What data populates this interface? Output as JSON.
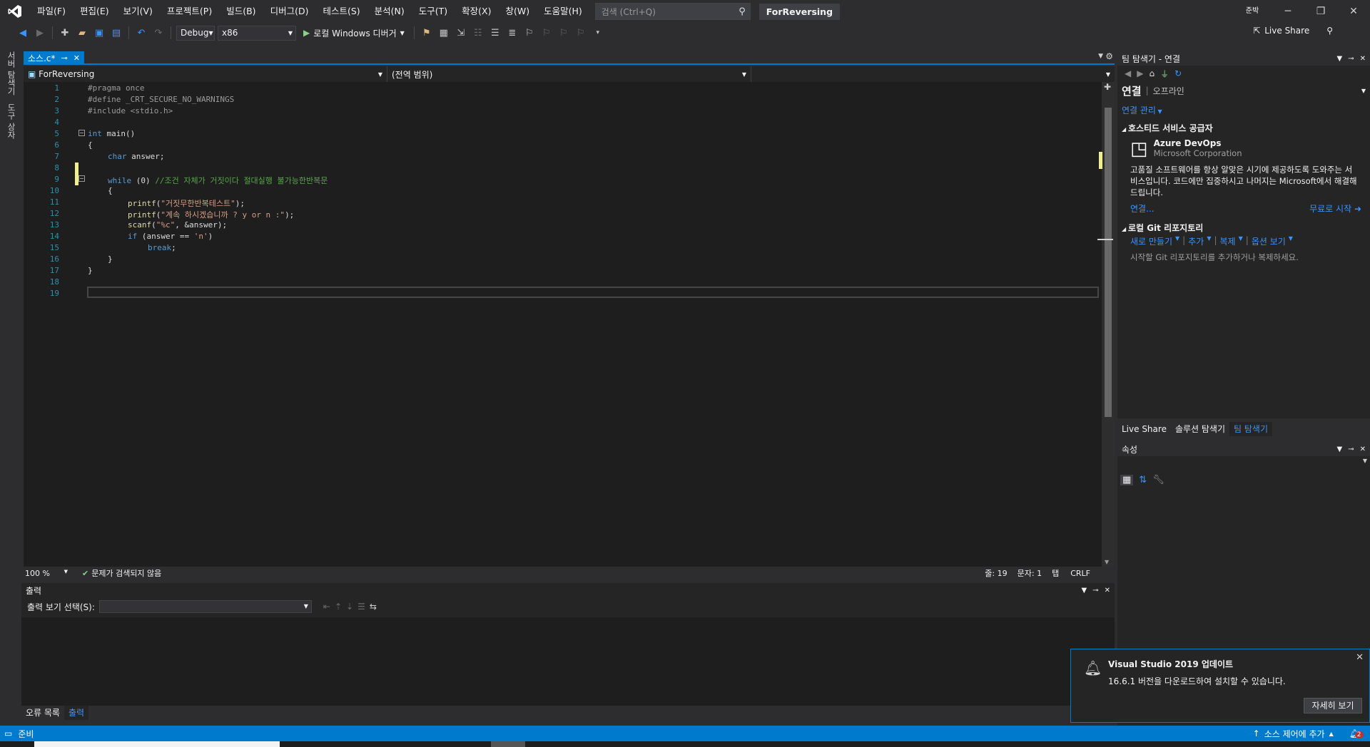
{
  "title_bar": {
    "menu": [
      "파일(F)",
      "편집(E)",
      "보기(V)",
      "프로젝트(P)",
      "빌드(B)",
      "디버그(D)",
      "테스트(S)",
      "분석(N)",
      "도구(T)",
      "확장(X)",
      "창(W)",
      "도움말(H)"
    ],
    "search_placeholder": "검색 (Ctrl+Q)",
    "solution_name": "ForReversing",
    "user_badge": "준박"
  },
  "toolbar": {
    "configuration": "Debug",
    "platform": "x86",
    "debug_launch": "로컬 Windows 디버거",
    "live_share": "Live Share"
  },
  "left_strip": {
    "tabs": [
      "서버 탐색기",
      "도구 상자"
    ]
  },
  "editor": {
    "tab_label": "소스.c*",
    "tab_pin": "ᵖ",
    "nav_project": "ForReversing",
    "nav_scope": "(전역 범위)",
    "line_numbers": [
      "1",
      "2",
      "3",
      "4",
      "5",
      "6",
      "7",
      "8",
      "9",
      "10",
      "11",
      "12",
      "13",
      "14",
      "15",
      "16",
      "17",
      "18",
      "19"
    ],
    "zoom": "100 %",
    "issues": "문제가 검색되지 않음",
    "line_info": "줄: 19",
    "col_info": "문자: 1",
    "tab_mode": "탭",
    "eol": "CRLF"
  },
  "code": {
    "l1": "#pragma once",
    "l2": "#define _CRT_SECURE_NO_WARNINGS",
    "l3": "#include <stdio.h>",
    "l5_kw": "int",
    "l5_rest": " main()",
    "l6": "{",
    "l7_kw": "char",
    "l7_rest": " answer;",
    "l9_kw": "while",
    "l9_rest": " (0) ",
    "l9_comment": "//조건 자체가 거짓이다 절대실행 불가능한반복문",
    "l10": "{",
    "l11_fn": "printf",
    "l11_str": "\"거짓무한반복테스트\"",
    "l12_fn": "printf",
    "l12_str": "\"계속 하시겠습니까 ? y or n :\"",
    "l13_fn": "scanf",
    "l13_str": "\"%c\"",
    "l13_rest": ", &answer);",
    "l14_kw": "if",
    "l14_rest": " (answer == ",
    "l14_str": "'n'",
    "l15_kw": "break",
    "l16": "}",
    "l17": "}"
  },
  "team_explorer": {
    "title": "팀 탐색기 - 연결",
    "heading": "연결",
    "status": "오프라인",
    "manage": "연결 관리",
    "hosted_title": "호스티드 서비스 공급자",
    "azure_name": "Azure DevOps",
    "azure_company": "Microsoft Corporation",
    "azure_desc": "고품질 소프트웨어를 항상 알맞은 시기에 제공하도록 도와주는 서비스입니다. 코드에만 집중하시고 나머지는 Microsoft에서 해결해 드립니다.",
    "connect": "연결...",
    "start_free": "무료로 시작",
    "git_title": "로컬 Git 리포지토리",
    "git_actions": [
      "새로 만들기",
      "추가",
      "복제",
      "옵션 보기"
    ],
    "git_hint": "시작할 Git 리포지토리를 추가하거나 복제하세요."
  },
  "right_tabs": [
    "Live Share",
    "솔루션 탐색기",
    "팀 탐색기"
  ],
  "properties": {
    "title": "속성"
  },
  "output": {
    "title": "출력",
    "show_label": "출력 보기 선택(S):",
    "tabs": [
      "오류 목록",
      "출력"
    ]
  },
  "notification": {
    "title": "Visual Studio 2019 업데이트",
    "message": "16.6.1 버전을 다운로드하여 설치할 수 있습니다.",
    "button": "자세히 보기"
  },
  "statusbar": {
    "ready": "준비",
    "source_control": "소스 제어에 추가",
    "notification_count": "2"
  },
  "colors": {
    "accent": "#007acc",
    "editor_bg": "#1e1e1e",
    "chrome_bg": "#2d2d30"
  }
}
